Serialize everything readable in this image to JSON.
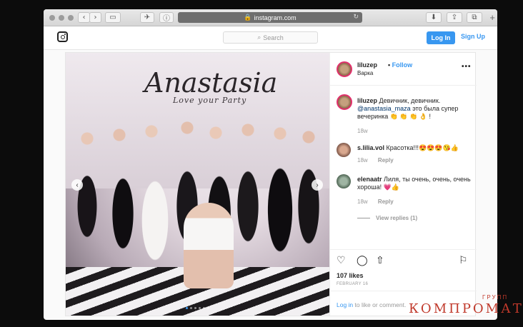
{
  "browser": {
    "url": "instagram.com",
    "icons": [
      "back-icon",
      "forward-icon",
      "sidebar-icon",
      "share-extension-icon",
      "info-icon",
      "lock-icon",
      "reload-icon",
      "download-icon",
      "share-icon",
      "tabs-icon",
      "new-tab-icon"
    ]
  },
  "header": {
    "search_placeholder": "Search",
    "login_label": "Log In",
    "signup_label": "Sign Up"
  },
  "post": {
    "photo": {
      "sign_text": "Anastasia",
      "sign_subtext": "Love your Party"
    },
    "username": "liluzep",
    "separator": "•",
    "follow_label": "Follow",
    "location": "Варка",
    "caption": {
      "user": "liluzep",
      "text_prefix": "Девичник, девичник.",
      "mention": "@anastasia_maza",
      "text_suffix": "это была супер вечеринка 👏 👏 👏 👌 !",
      "age": "18w"
    },
    "comments": [
      {
        "user": "s.lilia.vol",
        "text": "Красотка!!!😍😍😍😘👍",
        "age": "18w",
        "reply_label": "Reply"
      },
      {
        "user": "elenaatr",
        "text": "Лиля, ты очень, очень, очень хороша! 💗👍",
        "age": "18w",
        "reply_label": "Reply"
      }
    ],
    "view_replies": "View replies (1)",
    "likes": "107 likes",
    "date": "FEBRUARY 16",
    "login_prompt": {
      "link": "Log in",
      "text": "to like or comment."
    }
  },
  "watermark": {
    "small": "ГРУПП",
    "big": "КОМПРОМАТ"
  },
  "colors": {
    "accent": "#3897f0",
    "watermark": "#c0392b"
  }
}
